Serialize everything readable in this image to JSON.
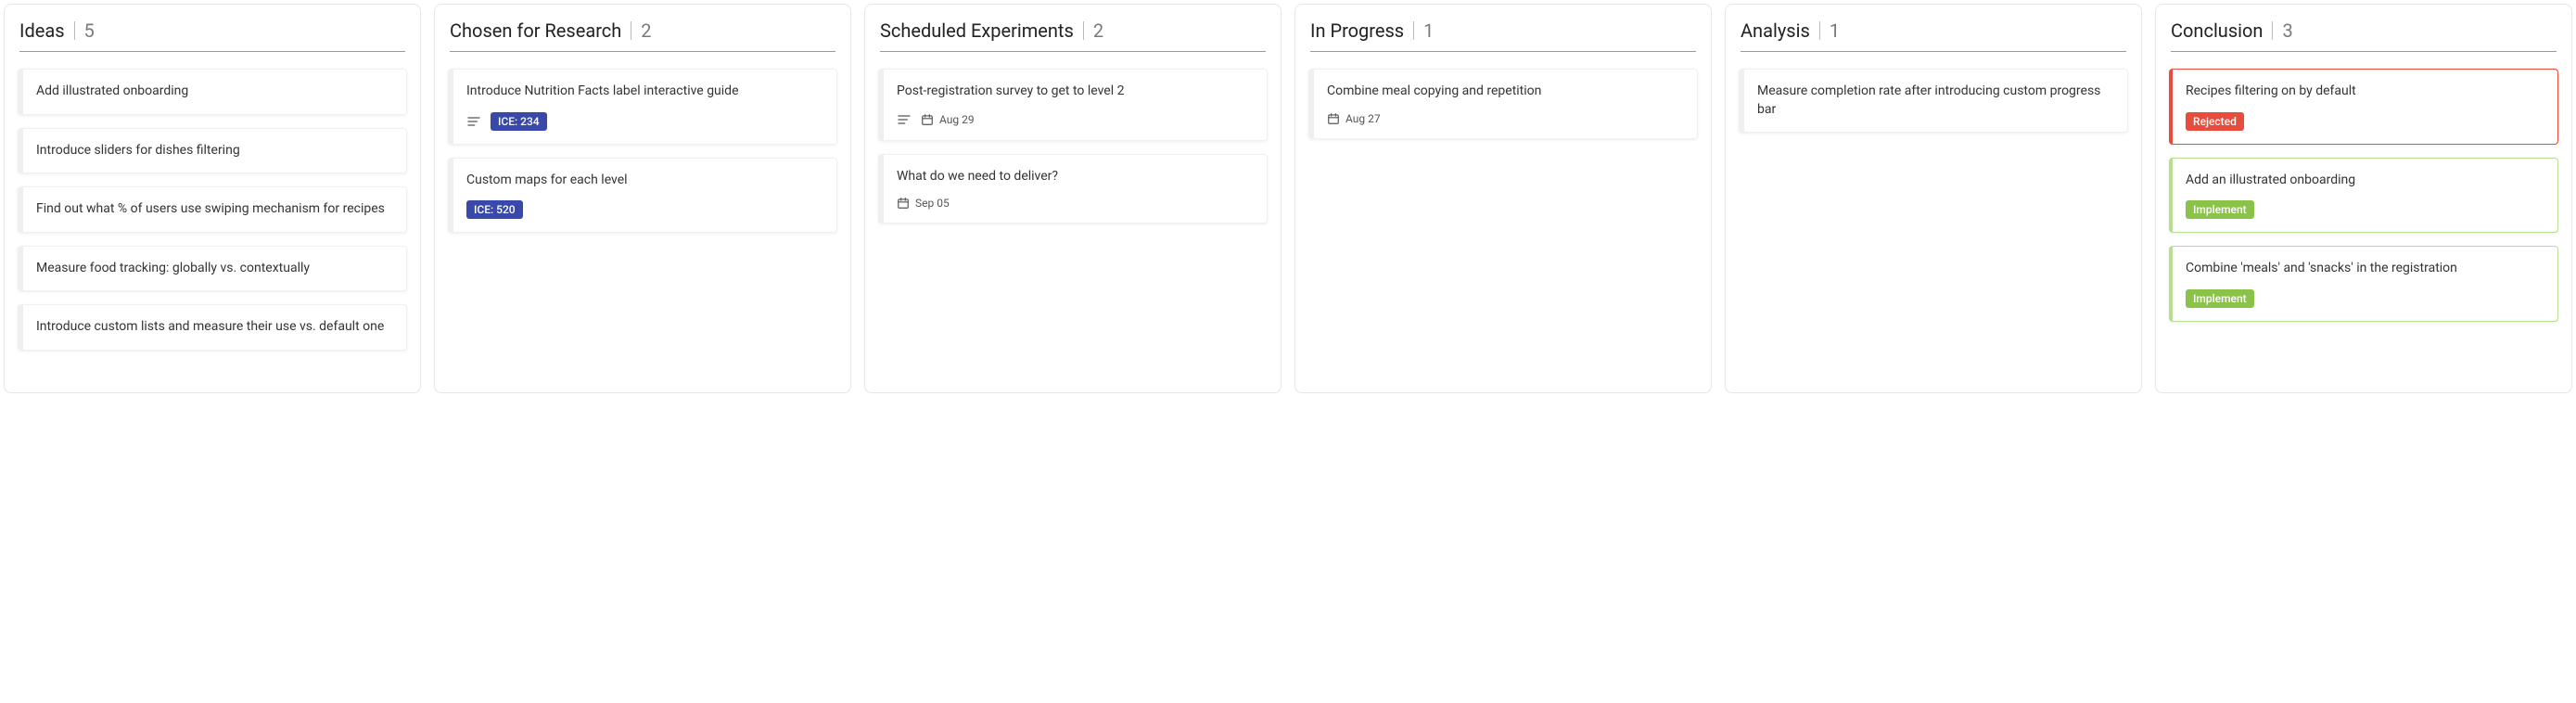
{
  "columns": [
    {
      "title": "Ideas",
      "count": "5",
      "cards": [
        {
          "title": "Add illustrated onboarding"
        },
        {
          "title": "Introduce sliders for dishes filtering"
        },
        {
          "title": "Find out what % of users use swiping mechanism for recipes"
        },
        {
          "title": "Measure food tracking: globally vs. contextually"
        },
        {
          "title": "Introduce custom lists and measure their use vs. default one"
        }
      ]
    },
    {
      "title": "Chosen for Research",
      "count": "2",
      "cards": [
        {
          "title": "Introduce Nutrition Facts label interactive guide",
          "desc": true,
          "ice": "ICE: 234"
        },
        {
          "title": "Custom maps for each level",
          "ice": "ICE: 520"
        }
      ]
    },
    {
      "title": "Scheduled Experiments",
      "count": "2",
      "cards": [
        {
          "title": "Post-registration survey to get to level 2",
          "desc": true,
          "date": "Aug 29"
        },
        {
          "title": "What do we need to deliver?",
          "date": "Sep 05"
        }
      ]
    },
    {
      "title": "In Progress",
      "count": "1",
      "cards": [
        {
          "title": "Combine meal copying and repetition",
          "date": "Aug 27"
        }
      ]
    },
    {
      "title": "Analysis",
      "count": "1",
      "cards": [
        {
          "title": "Measure completion rate after introducing custom progress bar"
        }
      ]
    },
    {
      "title": "Conclusion",
      "count": "3",
      "cards": [
        {
          "title": "Recipes filtering on by default",
          "status": "Rejected",
          "status_class": "rejected",
          "card_class": "red"
        },
        {
          "title": "Add an illustrated onboarding",
          "status": "Implement",
          "status_class": "implement",
          "card_class": "green"
        },
        {
          "title": "Combine 'meals' and 'snacks' in the registration",
          "status": "Implement",
          "status_class": "implement",
          "card_class": "green"
        }
      ]
    }
  ]
}
